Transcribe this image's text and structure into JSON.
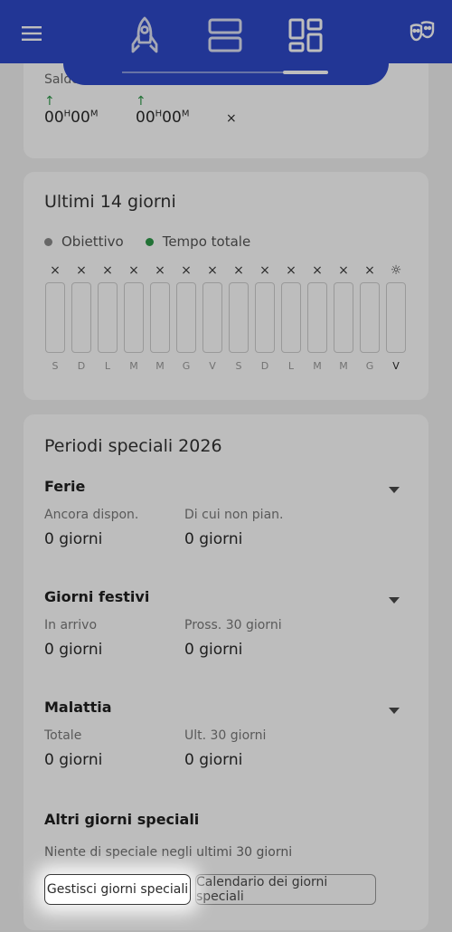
{
  "header": {
    "menu_icon": "menu-icon",
    "tabs": [
      {
        "icon": "rocket-icon"
      },
      {
        "icon": "rows-icon"
      },
      {
        "icon": "dashboard-icon"
      }
    ],
    "theater_icon": "theater-masks-icon",
    "accent": "#2f49c9"
  },
  "balance": {
    "label": "Saldo",
    "value1_hours": "00",
    "value1_hours_unit": "H",
    "value1_minutes": "00",
    "value1_minutes_unit": "M",
    "value2_hours": "00",
    "value2_hours_unit": "H",
    "value2_minutes": "00",
    "value2_minutes_unit": "M",
    "close": "×"
  },
  "last14": {
    "title": "Ultimi 14 giorni",
    "legend_goal": "Obiettivo",
    "legend_total": "Tempo totale",
    "goal_color": "#8c8c8c",
    "total_color": "#2e9a4a",
    "days": [
      {
        "mark": "×",
        "letter": "S"
      },
      {
        "mark": "×",
        "letter": "D"
      },
      {
        "mark": "×",
        "letter": "L"
      },
      {
        "mark": "×",
        "letter": "M"
      },
      {
        "mark": "×",
        "letter": "M"
      },
      {
        "mark": "×",
        "letter": "G"
      },
      {
        "mark": "×",
        "letter": "V"
      },
      {
        "mark": "×",
        "letter": "S"
      },
      {
        "mark": "×",
        "letter": "D"
      },
      {
        "mark": "×",
        "letter": "L"
      },
      {
        "mark": "×",
        "letter": "M"
      },
      {
        "mark": "×",
        "letter": "M"
      },
      {
        "mark": "×",
        "letter": "G"
      },
      {
        "mark": "☼",
        "letter": "V"
      }
    ]
  },
  "special": {
    "title": "Periodi speciali 2026",
    "ferie": {
      "title": "Ferie",
      "left_label": "Ancora dispon.",
      "left_value": "0 giorni",
      "right_label": "Di cui non pian.",
      "right_value": "0 giorni"
    },
    "festivi": {
      "title": "Giorni festivi",
      "left_label": "In arrivo",
      "left_value": "0 giorni",
      "right_label": "Pross. 30 giorni",
      "right_value": "0 giorni"
    },
    "malattia": {
      "title": "Malattia",
      "left_label": "Totale",
      "left_value": "0 giorni",
      "right_label": "Ult. 30 giorni",
      "right_value": "0 giorni"
    },
    "altri": {
      "title": "Altri giorni speciali",
      "note": "Niente di speciale negli ultimi 30 giorni",
      "manage_button": "Gestisci giorni speciali",
      "calendar_button": "Calendario dei giorni speciali"
    }
  }
}
